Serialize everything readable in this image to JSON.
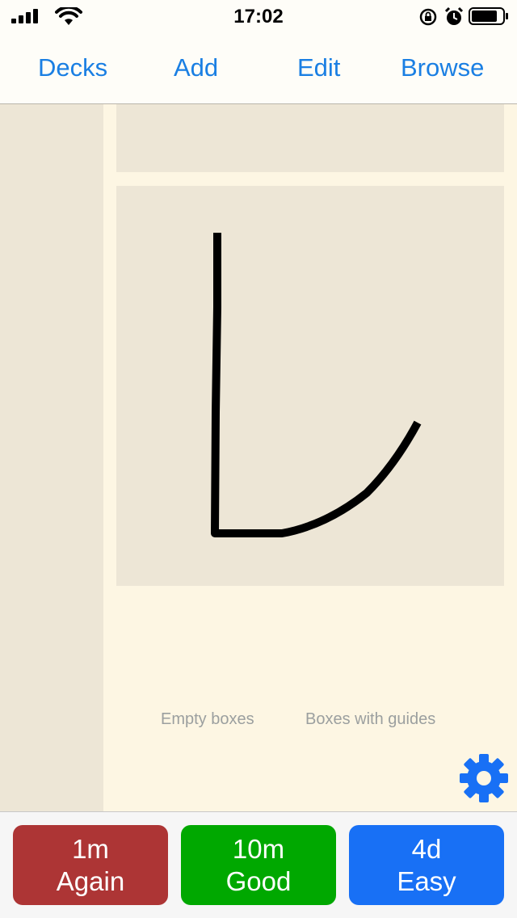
{
  "status_bar": {
    "time": "17:02",
    "icons": [
      "signal-icon",
      "wifi-icon",
      "rotation-lock-icon",
      "alarm-icon",
      "battery-icon"
    ]
  },
  "nav": {
    "decks": "Decks",
    "add": "Add",
    "edit": "Edit",
    "browse": "Browse"
  },
  "drawing": {
    "links": {
      "empty": "Empty boxes",
      "guides": "Boxes with guides"
    }
  },
  "answers": {
    "again": {
      "interval": "1m",
      "label": "Again"
    },
    "good": {
      "interval": "10m",
      "label": "Good"
    },
    "easy": {
      "interval": "4d",
      "label": "Easy"
    }
  },
  "colors": {
    "accent": "#1a7fe3",
    "again": "#ad3535",
    "good": "#00a800",
    "easy": "#1870f5",
    "card_bg": "#fdf6e3",
    "box_bg": "#ede6d6"
  }
}
